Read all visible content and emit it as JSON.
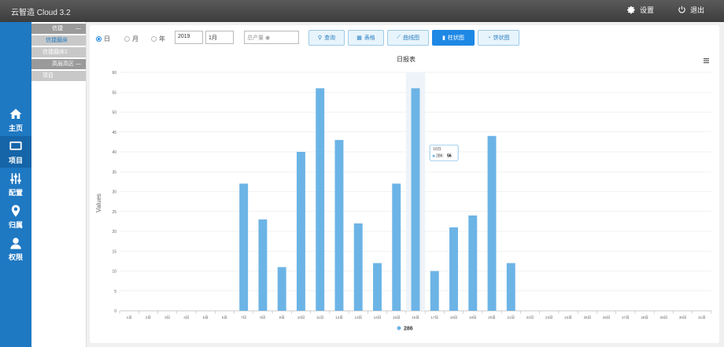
{
  "app": {
    "title": "云智造 Cloud 3.2"
  },
  "topbar": {
    "settings_label": "设置",
    "logout_label": "退出"
  },
  "nav": [
    {
      "label": "主页",
      "icon": "home-icon"
    },
    {
      "label": "项目",
      "icon": "monitor-icon",
      "active": true
    },
    {
      "label": "配置",
      "icon": "sliders-icon"
    },
    {
      "label": "归属",
      "icon": "location-pin-icon"
    },
    {
      "label": "权限",
      "icon": "user-icon"
    }
  ],
  "tree": [
    {
      "label": "信捷",
      "kind": "group",
      "toggle": "—"
    },
    {
      "label": "信捷磨床",
      "kind": "selected"
    },
    {
      "label": "信捷磨床1",
      "kind": "item"
    },
    {
      "label": "高层高区",
      "kind": "group",
      "toggle": "—"
    },
    {
      "label": "项目",
      "kind": "item"
    }
  ],
  "toolbar": {
    "period_options": [
      {
        "label": "日",
        "checked": true
      },
      {
        "label": "月",
        "checked": false
      },
      {
        "label": "年",
        "checked": false
      }
    ],
    "year_value": "2019",
    "month_value": "1月",
    "metric_placeholder": "总产量",
    "query_label": "查询",
    "table_label": "表格",
    "line_label": "曲线图",
    "bar_label": "柱状图",
    "pie_label": "饼状图"
  },
  "colors": {
    "bar": "#6cb4e6",
    "accent": "#1e88e5",
    "nav": "#1e78c2"
  },
  "chart_data": {
    "type": "bar",
    "title": "日报表",
    "ylabel": "Values",
    "ylim": [
      0,
      60
    ],
    "yticks": [
      0,
      5,
      10,
      15,
      20,
      25,
      30,
      35,
      40,
      45,
      50,
      55,
      60
    ],
    "categories": [
      "1日",
      "2日",
      "3日",
      "4日",
      "5日",
      "6日",
      "7日",
      "8日",
      "9日",
      "10日",
      "11日",
      "12日",
      "13日",
      "14日",
      "15日",
      "16日",
      "17日",
      "18日",
      "19日",
      "20日",
      "21日",
      "22日",
      "23日",
      "24日",
      "25日",
      "26日",
      "27日",
      "28日",
      "29日",
      "30日",
      "31日"
    ],
    "series": [
      {
        "name": "286",
        "values": [
          0,
          0,
          0,
          0,
          0,
          0,
          32,
          23,
          11,
          40,
          56,
          43,
          22,
          12,
          32,
          56,
          10,
          21,
          24,
          44,
          12,
          0,
          0,
          0,
          0,
          0,
          0,
          0,
          0,
          0,
          0
        ]
      }
    ],
    "grid": true,
    "legend": "bottom",
    "tooltip": {
      "title": "16日",
      "series": "286",
      "value": "56"
    }
  }
}
